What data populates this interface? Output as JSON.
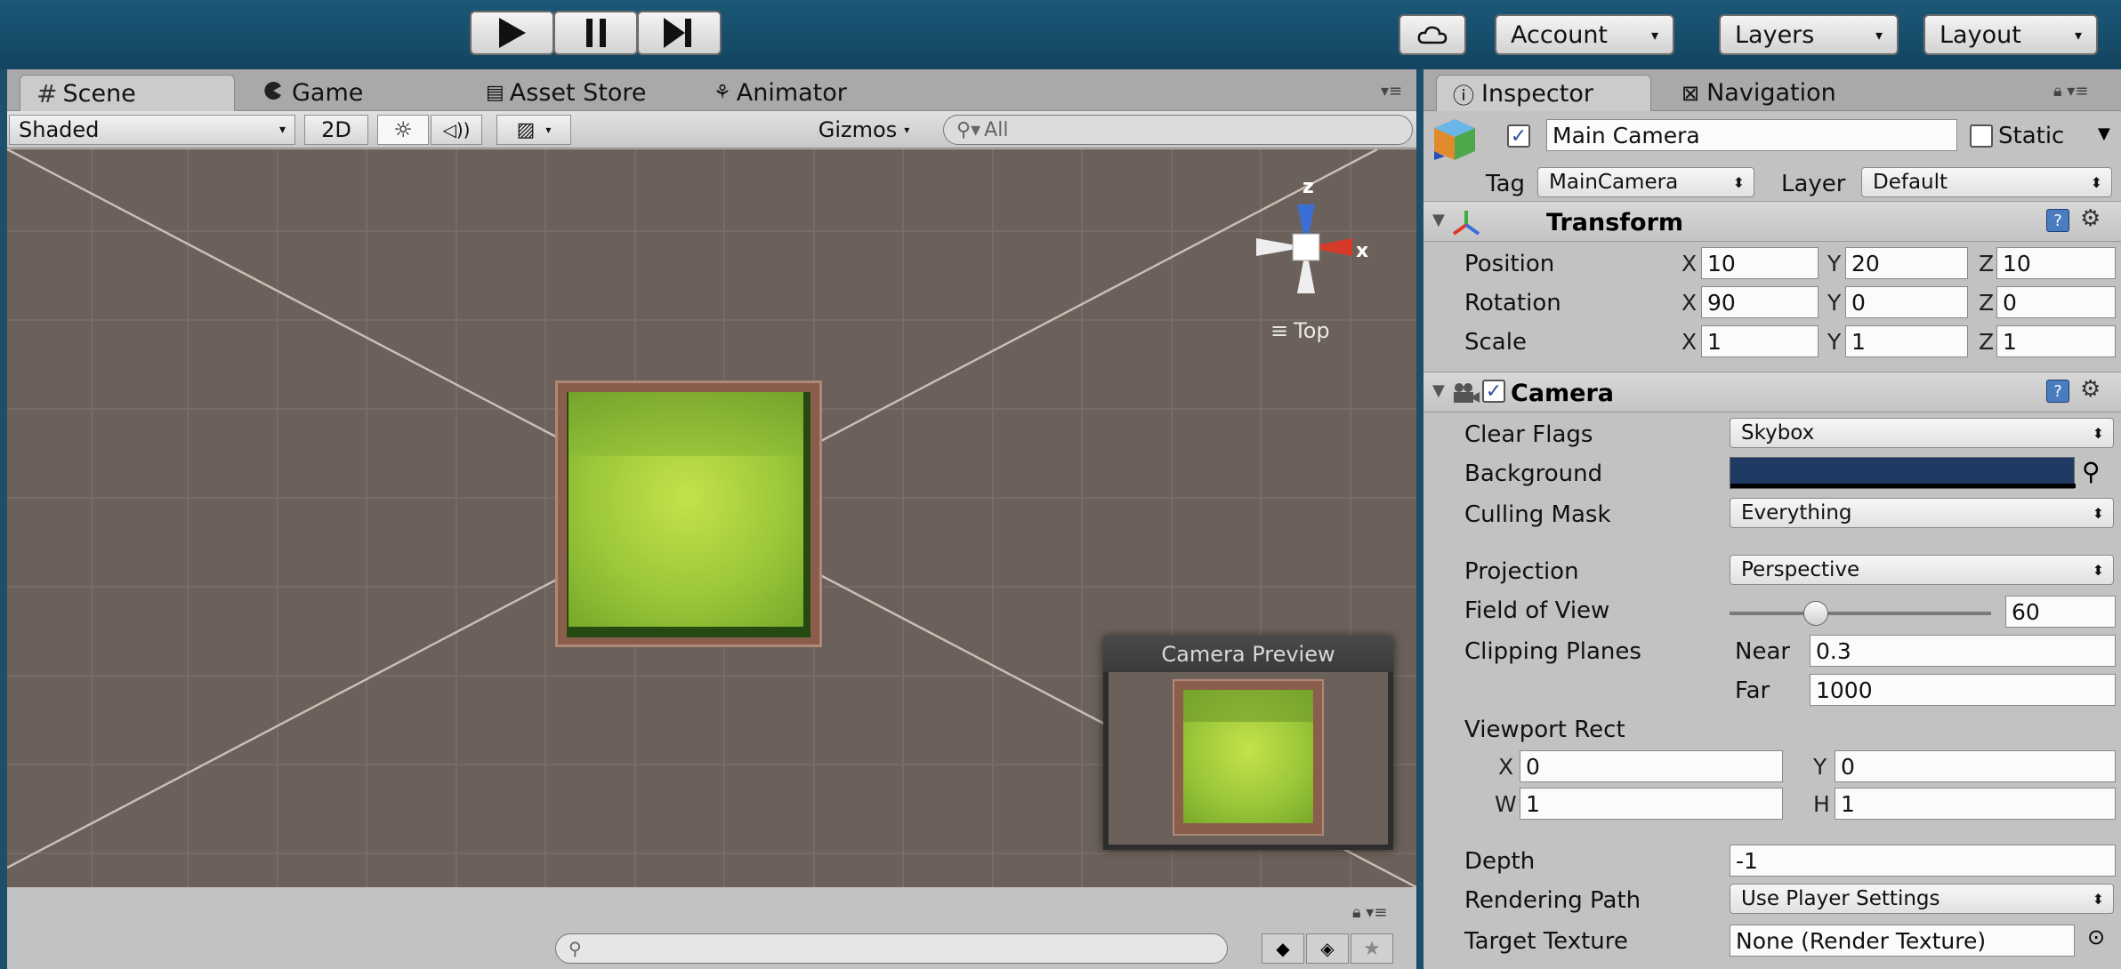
{
  "toolbar": {
    "play_icon": "play-icon",
    "pause_icon": "pause-icon",
    "step_icon": "step-icon",
    "cloud_icon": "cloud-icon",
    "account": "Account",
    "layers": "Layers",
    "layout": "Layout",
    "dropdown_arrow": "▾"
  },
  "tabs": {
    "scene": "Scene",
    "game": "Game",
    "asset_store": "Asset Store",
    "animator": "Animator",
    "inspector": "Inspector",
    "navigation": "Navigation"
  },
  "scene_toolbar": {
    "shading_mode": "Shaded",
    "mode_2d": "2D",
    "gizmos": "Gizmos",
    "search_placeholder": "All"
  },
  "gizmo": {
    "z_label": "z",
    "x_label": "x",
    "view_label": "Top"
  },
  "camera_preview": {
    "title": "Camera Preview"
  },
  "inspector": {
    "object_name": "Main Camera",
    "static_label": "Static",
    "tag_label": "Tag",
    "tag_value": "MainCamera",
    "layer_label": "Layer",
    "layer_value": "Default",
    "transform": {
      "title": "Transform",
      "position_label": "Position",
      "rotation_label": "Rotation",
      "scale_label": "Scale",
      "axis_x": "X",
      "axis_y": "Y",
      "axis_z": "Z",
      "position": {
        "x": "10",
        "y": "20",
        "z": "10"
      },
      "rotation": {
        "x": "90",
        "y": "0",
        "z": "0"
      },
      "scale": {
        "x": "1",
        "y": "1",
        "z": "1"
      }
    },
    "camera": {
      "title": "Camera",
      "clear_flags_label": "Clear Flags",
      "clear_flags_value": "Skybox",
      "background_label": "Background",
      "background_color": "#1f3a63",
      "culling_mask_label": "Culling Mask",
      "culling_mask_value": "Everything",
      "projection_label": "Projection",
      "projection_value": "Perspective",
      "fov_label": "Field of View",
      "fov_value": "60",
      "fov_fraction": 0.33,
      "clipping_label": "Clipping Planes",
      "near_label": "Near",
      "near_value": "0.3",
      "far_label": "Far",
      "far_value": "1000",
      "viewport_label": "Viewport Rect",
      "vp_x_label": "X",
      "vp_y_label": "Y",
      "vp_w_label": "W",
      "vp_h_label": "H",
      "vp_x": "0",
      "vp_y": "0",
      "vp_w": "1",
      "vp_h": "1",
      "depth_label": "Depth",
      "depth_value": "-1",
      "rendering_path_label": "Rendering Path",
      "rendering_path_value": "Use Player Settings",
      "target_texture_label": "Target Texture",
      "target_texture_value": "None (Render Texture)"
    }
  },
  "colors": {
    "toolbar_bg": "#1c5878",
    "viewport_bg": "#6b615a",
    "panel_bg": "#c2c2c2",
    "grass": "#9cc83a",
    "frame": "#8a5a4a"
  }
}
